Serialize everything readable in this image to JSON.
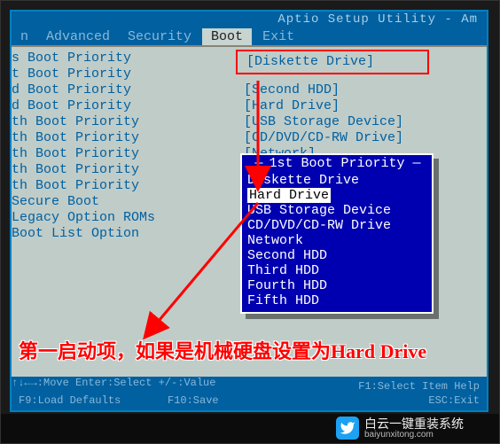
{
  "header": {
    "title": "Aptio Setup Utility - Am"
  },
  "menu": {
    "items": [
      "n",
      "Advanced",
      "Security",
      "Boot",
      "Exit"
    ],
    "selected_index": 3
  },
  "left_column": {
    "items": [
      "s Boot Priority",
      "t Boot Priority",
      "d Boot Priority",
      "d Boot Priority",
      "th Boot Priority",
      "th Boot Priority",
      "th Boot Priority",
      "th Boot Priority",
      "th Boot Priority",
      "",
      "Secure Boot",
      "Legacy Option ROMs",
      "Boot List Option"
    ]
  },
  "right_column": {
    "items": [
      "[Diskette Drive]",
      "[Second HDD]",
      "[Hard Drive]",
      "[USB Storage Device]",
      "[CD/DVD/CD-RW Drive]",
      "[Network]"
    ]
  },
  "popup": {
    "title": " 1st Boot Priority ",
    "items": [
      "Diskette Drive",
      "Hard Drive",
      "USB Storage Device",
      "CD/DVD/CD-RW Drive",
      "Network",
      "Second HDD",
      "Third HDD",
      "Fourth HDD",
      "Fifth HDD"
    ],
    "selected_index": 1
  },
  "help": {
    "r1c1": "↑↓←→:Move",
    "r1c2": "Enter:Select",
    "r1c3": "+/-:Value",
    "r2c1": "F9:Load Defaults",
    "r2c2": "F10:Save",
    "r2c3": "F1:Select Item  Help",
    "r2c3b": "ESC:Exit"
  },
  "caption": "第一启动项，如果是机械硬盘设置为Hard Drive",
  "watermark": {
    "name": "白云一键重装系统",
    "url": "baiyunxitong.com"
  }
}
